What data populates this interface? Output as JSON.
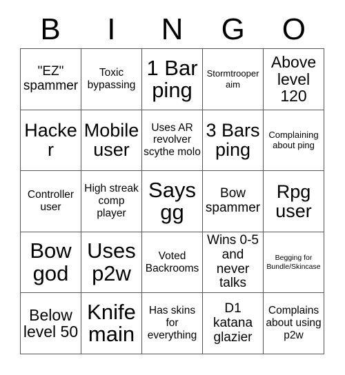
{
  "card": {
    "title": "BINGO",
    "header_letters": [
      "B",
      "I",
      "N",
      "G",
      "O"
    ],
    "grid_size": "5x5",
    "colors": {
      "background": "#ffffff",
      "text": "#000000",
      "grid_line": "#555555"
    },
    "rows": [
      [
        {
          "text": "\"EZ\" spammer",
          "size": "m"
        },
        {
          "text": "Toxic bypassing",
          "size": "s"
        },
        {
          "text": "1 Bar ping",
          "size": "xxl"
        },
        {
          "text": "Stormtrooper aim",
          "size": "xs"
        },
        {
          "text": "Above level 120",
          "size": "l"
        }
      ],
      [
        {
          "text": "Hacker",
          "size": "xl"
        },
        {
          "text": "Mobile user",
          "size": "xl"
        },
        {
          "text": "Uses AR revolver scythe molo",
          "size": "s"
        },
        {
          "text": "3 Bars ping",
          "size": "xl"
        },
        {
          "text": "Complaining about ping",
          "size": "xs"
        }
      ],
      [
        {
          "text": "Controller user",
          "size": "s"
        },
        {
          "text": "High streak comp player",
          "size": "s"
        },
        {
          "text": "Says gg",
          "size": "xxl"
        },
        {
          "text": "Bow spammer",
          "size": "m"
        },
        {
          "text": "Rpg user",
          "size": "xl"
        }
      ],
      [
        {
          "text": "Bow god",
          "size": "xxl"
        },
        {
          "text": "Uses p2w",
          "size": "xxl"
        },
        {
          "text": "Voted Backrooms",
          "size": "s"
        },
        {
          "text": "Wins 0-5 and never talks",
          "size": "m"
        },
        {
          "text": "Begging for Bundle/Skincase",
          "size": "xxs"
        }
      ],
      [
        {
          "text": "Below level 50",
          "size": "l"
        },
        {
          "text": "Knife main",
          "size": "xxl"
        },
        {
          "text": "Has skins for everything",
          "size": "s"
        },
        {
          "text": "D1 katana glazier",
          "size": "m"
        },
        {
          "text": "Complains about using p2w",
          "size": "s"
        }
      ]
    ]
  }
}
